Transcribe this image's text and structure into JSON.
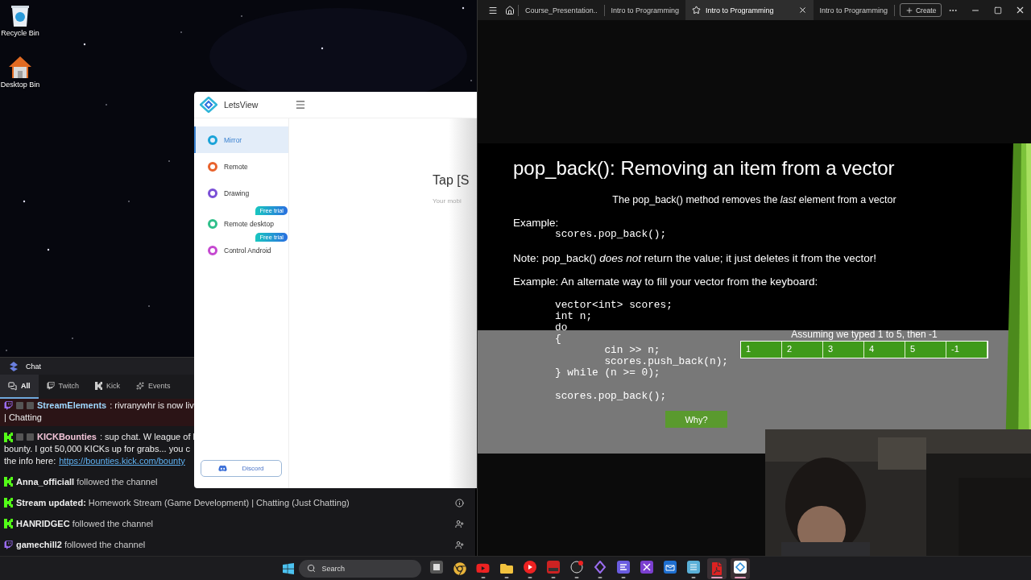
{
  "desktop": {
    "icons": [
      {
        "kind": "recycle",
        "label": "Recycle Bin"
      },
      {
        "kind": "home",
        "label": "Desktop Bin"
      }
    ]
  },
  "chat_window": {
    "title": "Chat",
    "tabs": [
      {
        "kind": "all",
        "label": "All",
        "selected": true
      },
      {
        "kind": "twitch",
        "label": "Twitch",
        "selected": false
      },
      {
        "kind": "kick",
        "label": "Kick",
        "selected": false
      },
      {
        "kind": "events",
        "label": "Events",
        "selected": false
      }
    ],
    "messages": [
      {
        "kind": "twitch-chat",
        "highlighted": true,
        "author": "StreamElements",
        "color": "#9fd8ff",
        "lines": [
          ": rivranywhr is now liv",
          "| Chatting"
        ]
      },
      {
        "kind": "kick-chat",
        "highlighted": false,
        "author": "KICKBounties",
        "color": "#f3c4d8",
        "lines": [
          ": sup chat. W league of l",
          "bounty. I got 50,000 KICKs up for grabs... you c"
        ],
        "link_line": {
          "text": "the info here:",
          "link": "https://bounties.kick.com/bounty"
        }
      },
      {
        "kind": "kick-event",
        "author": "Anna_officiall",
        "text": "followed the channel"
      },
      {
        "kind": "kick-update",
        "author": "Stream updated:",
        "text": "Homework Stream (Game Development) | Chatting (Just Chatting)"
      },
      {
        "kind": "kick-follow",
        "author": "HANRIDGEC",
        "text": "followed the channel"
      },
      {
        "kind": "twitch-follow",
        "author": "gamechill2",
        "text": "followed the channel"
      }
    ]
  },
  "letsview": {
    "title": "LetsView",
    "nav": [
      {
        "label": "Mirror",
        "selected": true,
        "color": "#1aa3d8"
      },
      {
        "label": "Remote",
        "selected": false,
        "color": "#e8622c"
      },
      {
        "label": "Drawing",
        "selected": false,
        "color": "#7a4fd6"
      },
      {
        "label": "Remote desktop",
        "selected": false,
        "color": "#2fbf8a",
        "badge": "Free trial"
      },
      {
        "label": "Control Android",
        "selected": false,
        "color": "#c548d0",
        "badge": "Free trial"
      }
    ],
    "discord_button": "Discord",
    "heading": "Tap [S",
    "hint": "Your mobi"
  },
  "browser": {
    "tabs": [
      {
        "label": "Course_Presentation..",
        "selected": false
      },
      {
        "label": "Intro to Programming",
        "selected": false
      },
      {
        "label": "Intro to Programming",
        "selected": true
      },
      {
        "label": "Intro to Programming",
        "selected": false
      }
    ],
    "create_button": "Create"
  },
  "slide": {
    "title": "pop_back(): Removing an item from a vector",
    "subtitle": "The pop_back() method removes the *last* element from a vector",
    "example_label": "Example:",
    "example_code": "scores.pop_back();",
    "note": "Note: pop_back() *does not* return the value; it just deletes it from the vector!",
    "example2_label": "Example: An alternate way to fill your vector from the keyboard:",
    "code_lines": [
      "vector<int> scores;",
      "int n;",
      "do",
      "{",
      "        cin >> n;",
      "        scores.push_back(n);",
      "} while (n >= 0);"
    ],
    "code_tail": "scores.pop_back();",
    "table_caption": "Assuming we typed 1 to 5, then -1",
    "table_cells": [
      "1",
      "2",
      "3",
      "4",
      "5",
      "-1"
    ],
    "why_button": "Why?"
  },
  "taskbar": {
    "search": "Search",
    "apps": [
      {
        "kind": "taskview",
        "running": false,
        "active": false
      },
      {
        "kind": "chrome",
        "running": false,
        "active": false
      },
      {
        "kind": "youtube",
        "running": true,
        "active": false
      },
      {
        "kind": "folder",
        "running": true,
        "active": false
      },
      {
        "kind": "ytmusic",
        "running": true,
        "active": false
      },
      {
        "kind": "mixer",
        "running": true,
        "active": false
      },
      {
        "kind": "obs",
        "running": true,
        "active": false
      },
      {
        "kind": "streamer",
        "running": true,
        "active": false
      },
      {
        "kind": "lines",
        "running": true,
        "active": false
      },
      {
        "kind": "vs",
        "running": false,
        "active": false
      },
      {
        "kind": "mail",
        "running": false,
        "active": false
      },
      {
        "kind": "notepad",
        "running": true,
        "active": false
      },
      {
        "kind": "pdf",
        "running": true,
        "active": true
      },
      {
        "kind": "letsview",
        "running": true,
        "active": true
      }
    ]
  }
}
